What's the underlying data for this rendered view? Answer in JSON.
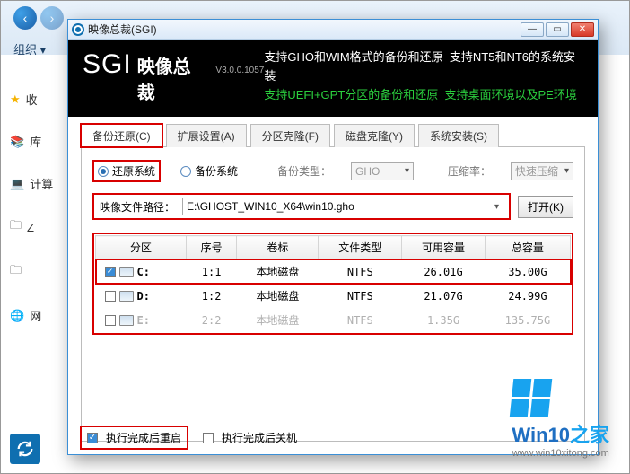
{
  "bg": {
    "org_label": "组织 ▾",
    "sidebar": [
      {
        "icon": "★",
        "label": "收"
      },
      {
        "icon": "📚",
        "label": "库"
      },
      {
        "icon": "💻",
        "label": "计算"
      },
      {
        "icon": "🔠",
        "label": "Z"
      },
      {
        "icon": "🗄",
        "label": ""
      },
      {
        "icon": "🌐",
        "label": "网"
      }
    ]
  },
  "window": {
    "title": "映像总裁(SGI)",
    "logo_main": "SGI",
    "logo_sub": "映像总裁",
    "logo_version": "V3.0.0.1057",
    "header_line1_a": "支持GHO和WIM格式的备份和还原",
    "header_line1_b": "支持NT5和NT6的系统安装",
    "header_line2_a": "支持UEFI+GPT分区的备份和还原",
    "header_line2_b": "支持桌面环境以及PE环境"
  },
  "tabs": [
    {
      "label": "备份还原(C)",
      "active": true
    },
    {
      "label": "扩展设置(A)",
      "active": false
    },
    {
      "label": "分区克隆(F)",
      "active": false
    },
    {
      "label": "磁盘克隆(Y)",
      "active": false
    },
    {
      "label": "系统安装(S)",
      "active": false
    }
  ],
  "mode": {
    "restore_label": "还原系统",
    "backup_label": "备份系统",
    "type_label": "备份类型：",
    "type_value": "GHO",
    "ratio_label": "压缩率：",
    "ratio_value": "快速压缩"
  },
  "path": {
    "label": "映像文件路径：",
    "value": "E:\\GHOST_WIN10_X64\\win10.gho",
    "open_btn": "打开(K)"
  },
  "table": {
    "cols": [
      "分区",
      "序号",
      "卷标",
      "文件类型",
      "可用容量",
      "总容量"
    ],
    "rows": [
      {
        "chk": true,
        "drive": "C:",
        "idx": "1:1",
        "vol": "本地磁盘",
        "fs": "NTFS",
        "free": "26.01G",
        "total": "35.00G",
        "selected": true
      },
      {
        "chk": false,
        "drive": "D:",
        "idx": "1:2",
        "vol": "本地磁盘",
        "fs": "NTFS",
        "free": "21.07G",
        "total": "24.99G"
      },
      {
        "chk": false,
        "drive": "E:",
        "idx": "2:2",
        "vol": "本地磁盘",
        "fs": "NTFS",
        "free": "1.35G",
        "total": "135.75G",
        "faint": true
      }
    ]
  },
  "bottom": {
    "restart_label": "执行完成后重启",
    "shutdown_label": "执行完成后关机"
  },
  "watermark": {
    "brand_a": "Win10",
    "brand_b": "之家",
    "url": "www.win10xitong.com"
  }
}
